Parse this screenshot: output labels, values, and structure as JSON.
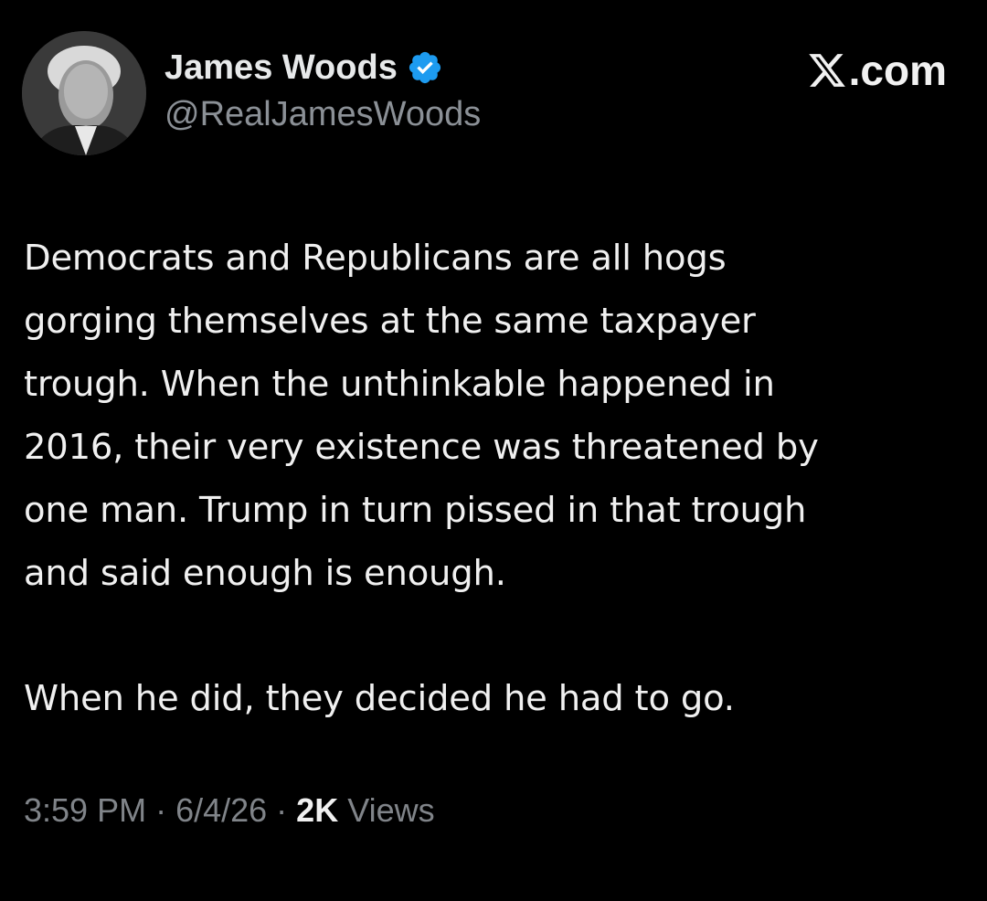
{
  "author": {
    "display_name": "James Woods",
    "handle": "@RealJamesWoods",
    "verified_icon": "verified-badge-icon",
    "avatar_icon": "avatar-photo"
  },
  "brand": {
    "label": ".com",
    "logo_icon": "x-logo-icon"
  },
  "tweet": {
    "paragraph_1": "Democrats and Republicans are all hogs\ngorging themselves at the same taxpayer\ntrough. When the unthinkable happened in\n2016, their very existence was threatened by\none man. Trump in turn pissed in that trough\nand said enough is enough.",
    "paragraph_2": "When he did, they decided he had to go."
  },
  "meta": {
    "time": "3:59 PM",
    "separator_1": " · ",
    "date": "6/4/26",
    "separator_2": " · ",
    "views_count": "2K",
    "views_label": " Views"
  },
  "colors": {
    "background": "#000000",
    "text": "#e7e9ea",
    "secondary": "#71767b",
    "verified": "#1d9bf0"
  }
}
